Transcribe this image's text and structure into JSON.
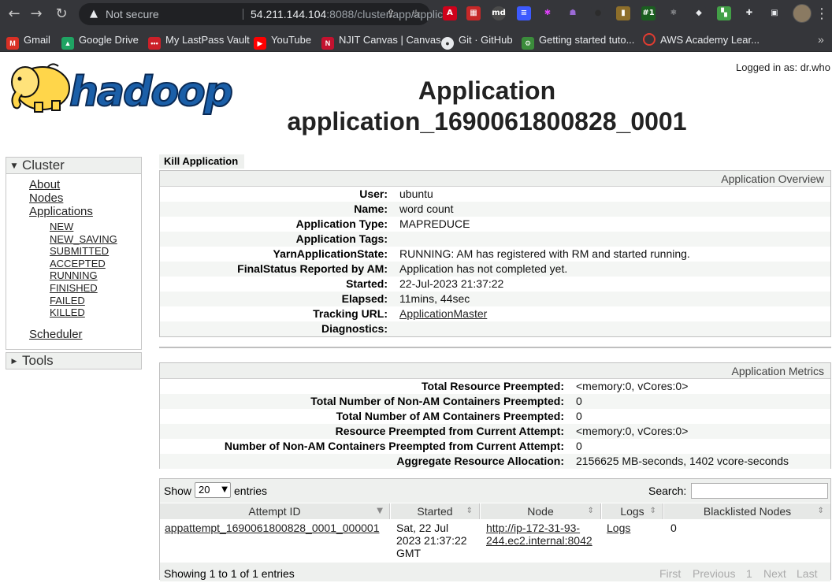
{
  "browser": {
    "security_label": "Not secure",
    "url_host": "54.211.144.104",
    "url_rest": ":8088/cluster/app/applic...",
    "bookmarks": [
      {
        "label": "Gmail",
        "color": "#d93025",
        "glyph": "M"
      },
      {
        "label": "Google Drive",
        "color": "#1fa463",
        "glyph": "▲"
      },
      {
        "label": "My LastPass Vault",
        "color": "#cc2029",
        "glyph": "•••"
      },
      {
        "label": "YouTube",
        "color": "#ff0000",
        "glyph": "▶"
      },
      {
        "label": "NJIT Canvas | Canvas",
        "color": "#c4122f",
        "glyph": "N"
      },
      {
        "label": "Git · GitHub",
        "color": "#333333",
        "glyph": "●"
      },
      {
        "label": "Getting started tuto...",
        "color": "#3b8c3b",
        "glyph": "⚙"
      },
      {
        "label": "AWS Academy Lear...",
        "color": "#e03c31",
        "glyph": "○"
      }
    ],
    "more_bookmarks": "»"
  },
  "header": {
    "logo_text": "hadoop",
    "logged_in": "Logged in as: dr.who",
    "title_line1": "Application",
    "title_line2": "application_1690061800828_0001"
  },
  "sidebar": {
    "cluster_label": "Cluster",
    "tools_label": "Tools",
    "links": [
      {
        "label": "About",
        "level": 1
      },
      {
        "label": "Nodes",
        "level": 1
      },
      {
        "label": "Applications",
        "level": 1
      },
      {
        "label": "NEW",
        "level": 2
      },
      {
        "label": "NEW_SAVING",
        "level": 2
      },
      {
        "label": "SUBMITTED",
        "level": 2
      },
      {
        "label": "ACCEPTED",
        "level": 2
      },
      {
        "label": "RUNNING",
        "level": 2
      },
      {
        "label": "FINISHED",
        "level": 2
      },
      {
        "label": "FAILED",
        "level": 2
      },
      {
        "label": "KILLED",
        "level": 2
      },
      {
        "label": "Scheduler",
        "level": 1
      }
    ]
  },
  "main": {
    "kill_label": "Kill Application",
    "overview": {
      "title": "Application Overview",
      "rows": [
        {
          "key": "User:",
          "value": "ubuntu"
        },
        {
          "key": "Name:",
          "value": "word count"
        },
        {
          "key": "Application Type:",
          "value": "MAPREDUCE"
        },
        {
          "key": "Application Tags:",
          "value": ""
        },
        {
          "key": "YarnApplicationState:",
          "value": "RUNNING: AM has registered with RM and started running."
        },
        {
          "key": "FinalStatus Reported by AM:",
          "value": "Application has not completed yet."
        },
        {
          "key": "Started:",
          "value": "22-Jul-2023 21:37:22"
        },
        {
          "key": "Elapsed:",
          "value": "11mins, 44sec"
        },
        {
          "key": "Tracking URL:",
          "value": "ApplicationMaster"
        },
        {
          "key": "Diagnostics:",
          "value": ""
        }
      ]
    },
    "metrics": {
      "title": "Application Metrics",
      "rows": [
        {
          "key": "Total Resource Preempted:",
          "value": "<memory:0, vCores:0>"
        },
        {
          "key": "Total Number of Non-AM Containers Preempted:",
          "value": "0"
        },
        {
          "key": "Total Number of AM Containers Preempted:",
          "value": "0"
        },
        {
          "key": "Resource Preempted from Current Attempt:",
          "value": "<memory:0, vCores:0>"
        },
        {
          "key": "Number of Non-AM Containers Preempted from Current Attempt:",
          "value": "0"
        },
        {
          "key": "Aggregate Resource Allocation:",
          "value": "2156625 MB-seconds, 1402 vcore-seconds"
        }
      ]
    },
    "attempts": {
      "show_label": "Show",
      "page_length": "20",
      "entries_label": "entries",
      "search_label": "Search:",
      "search_value": "",
      "columns": [
        "Attempt ID",
        "Started",
        "Node",
        "Logs",
        "Blacklisted Nodes"
      ],
      "rows": [
        {
          "attempt_id": "appattempt_1690061800828_0001_000001",
          "started_1": "Sat, 22 Jul",
          "started_2": "2023 21:37:22",
          "started_3": "GMT",
          "node_1": "http://ip-172-31-93-",
          "node_2": "244.ec2.internal:8042",
          "logs": "Logs",
          "blacklisted": "0"
        }
      ],
      "info": "Showing 1 to 1 of 1 entries",
      "pager": {
        "first": "First",
        "previous": "Previous",
        "page": "1",
        "next": "Next",
        "last": "Last"
      }
    }
  }
}
